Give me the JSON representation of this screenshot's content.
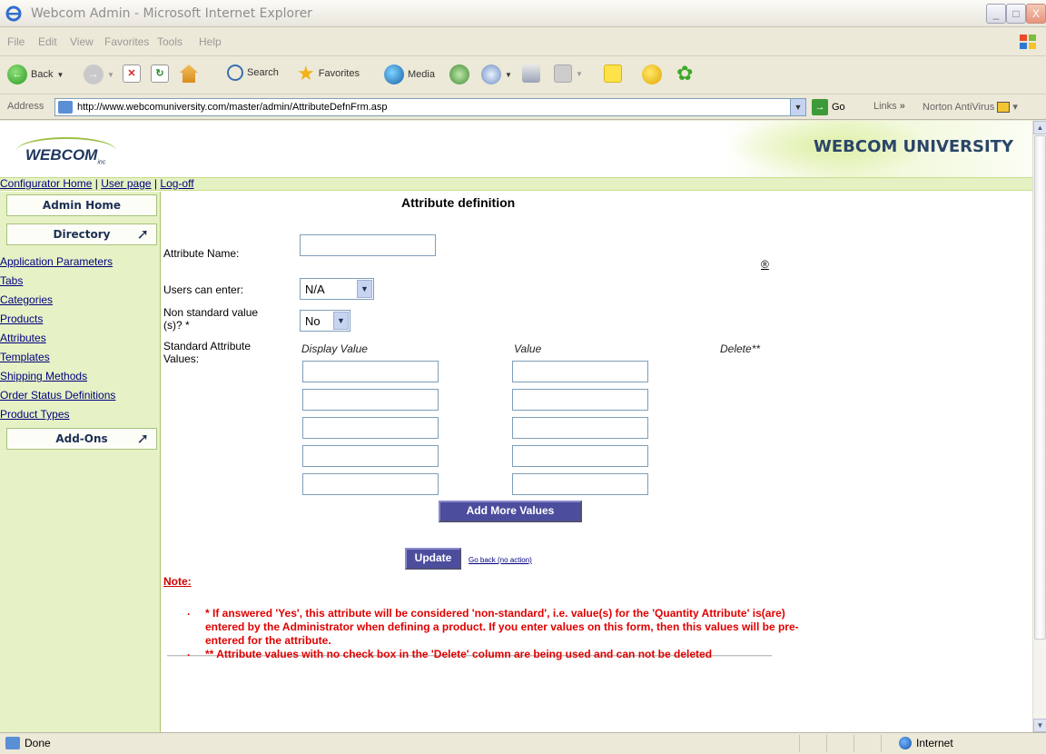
{
  "window": {
    "title": "Webcom Admin - Microsoft Internet Explorer",
    "controls": {
      "minimize": "_",
      "maximize": "□",
      "close": "X"
    }
  },
  "menu": {
    "items": [
      "File",
      "Edit",
      "View",
      "Favorites",
      "Tools",
      "Help"
    ]
  },
  "toolbar": {
    "back_label": "Back",
    "search_label": "Search",
    "favorites_label": "Favorites",
    "media_label": "Media"
  },
  "address": {
    "label": "Address",
    "url": "http://www.webcomuniversity.com/master/admin/AttributeDefnFrm.asp",
    "go_label": "Go",
    "links_label": "Links",
    "chevron": "»",
    "norton_label": "Norton AntiVirus"
  },
  "banner": {
    "logo": "WEBCOM",
    "logo_suffix": "inc",
    "university": "WEBCOM UNIVERSITY"
  },
  "top_links": {
    "configurator_home": "Configurator Home",
    "user_page": "User page",
    "log_off": "Log-off",
    "separator": "|"
  },
  "sidebar": {
    "admin_home": "Admin Home",
    "directory": "Directory",
    "items": [
      "Application Parameters",
      "Tabs",
      "Categories",
      "Products",
      "Attributes",
      "Templates",
      "Shipping Methods",
      "Order Status Definitions",
      "Product Types"
    ],
    "addons": "Add-Ons"
  },
  "form": {
    "title": "Attribute definition",
    "attribute_name_label": "Attribute Name:",
    "attribute_name_value": "",
    "registered_mark": "®",
    "users_can_enter_label": "Users can enter:",
    "users_can_enter_value": "N/A",
    "non_standard_label_line1": "Non standard value",
    "non_standard_label_line2": "(s)? *",
    "non_standard_value": "No",
    "standard_values_label_line1": "Standard Attribute",
    "standard_values_label_line2": "Values:",
    "col_display_value": "Display Value",
    "col_value": "Value",
    "col_delete": "Delete**",
    "rows": [
      {
        "display": "",
        "value": ""
      },
      {
        "display": "",
        "value": ""
      },
      {
        "display": "",
        "value": ""
      },
      {
        "display": "",
        "value": ""
      },
      {
        "display": "",
        "value": ""
      }
    ],
    "add_more_label": "Add More Values",
    "update_label": "Update",
    "go_back_label": "Go back (no action)"
  },
  "notes": {
    "heading": "Note:",
    "items": [
      "* If answered 'Yes', this attribute will be considered 'non-standard', i.e. value(s) for the 'Quantity Attribute' is(are) entered by the Administrator when defining a product. If you enter values on this form, then this values will be pre-entered for the attribute.",
      "** Attribute values with no check box in the 'Delete' column are being used and can not be deleted"
    ]
  },
  "status": {
    "text": "Done",
    "zone": "Internet"
  },
  "colors": {
    "sidebar_bg": "#e6f2c5",
    "button_blue": "#4d4d9e",
    "note_red": "#e00000",
    "link_blue": "#00007f",
    "brand_navy": "#2b4569"
  }
}
